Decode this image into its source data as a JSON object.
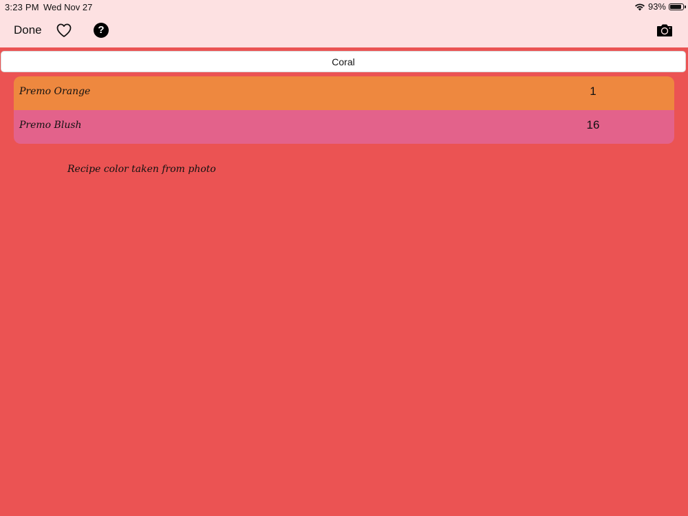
{
  "status_bar": {
    "time": "3:23 PM",
    "date": "Wed Nov 27",
    "battery_percent": "93%",
    "battery_level": 0.93
  },
  "nav": {
    "done_label": "Done",
    "help_label": "?",
    "icons": [
      "heart-icon",
      "help-icon",
      "camera-icon"
    ]
  },
  "color_name": {
    "value": "Coral"
  },
  "recipe": {
    "rows": [
      {
        "name": "Premo Orange",
        "qty": "1",
        "color": "#EE883F"
      },
      {
        "name": "Premo Blush",
        "qty": "16",
        "color": "#E3628B"
      }
    ]
  },
  "note": "Recipe color taken from photo",
  "colors": {
    "background": "#EB5353",
    "header": "#FDE1E2"
  }
}
